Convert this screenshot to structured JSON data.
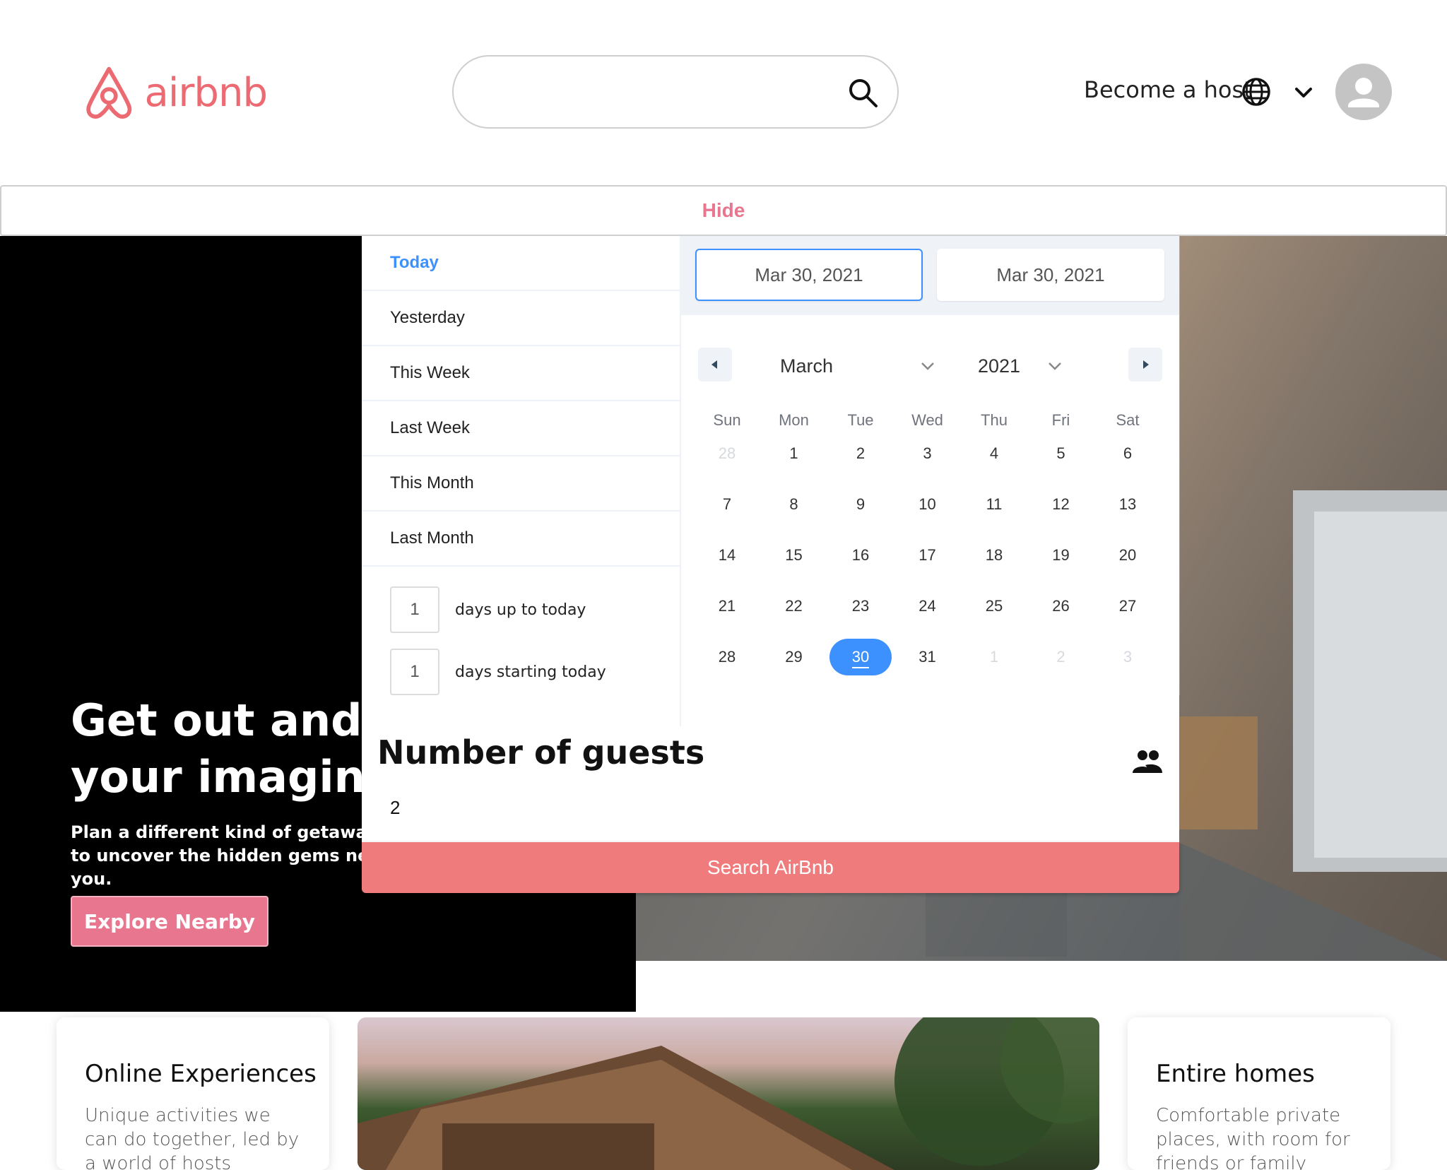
{
  "header": {
    "logo_text": "airbnb",
    "search_placeholder": "",
    "become_host": "Become a host",
    "brand_color": "#ec6b73"
  },
  "hide_label": "Hide",
  "hero": {
    "title_line1": "Get out and stretch",
    "title_line2": "your imagination",
    "subtitle": "Plan a different kind of getaway to uncover the hidden gems near you.",
    "cta": "Explore Nearby"
  },
  "picker": {
    "ranges": [
      "Today",
      "Yesterday",
      "This Week",
      "Last Week",
      "This Month",
      "Last Month"
    ],
    "active_range": "Today",
    "days_up_value": "1",
    "days_up_label": "days up to today",
    "days_start_value": "1",
    "days_start_label": "days starting today",
    "start_date": "Mar 30, 2021",
    "end_date": "Mar 30, 2021",
    "month": "March",
    "year": "2021",
    "weekdays": [
      "Sun",
      "Mon",
      "Tue",
      "Wed",
      "Thu",
      "Fri",
      "Sat"
    ],
    "weeks": [
      [
        "28",
        "1",
        "2",
        "3",
        "4",
        "5",
        "6"
      ],
      [
        "7",
        "8",
        "9",
        "10",
        "11",
        "12",
        "13"
      ],
      [
        "14",
        "15",
        "16",
        "17",
        "18",
        "19",
        "20"
      ],
      [
        "21",
        "22",
        "23",
        "24",
        "25",
        "26",
        "27"
      ],
      [
        "28",
        "29",
        "30",
        "31",
        "1",
        "2",
        "3"
      ]
    ],
    "selected_day": "30",
    "accent_color": "#3d91ff"
  },
  "guests": {
    "title": "Number of guests",
    "value": "2",
    "icon": "people-icon"
  },
  "search_button": "Search AirBnb",
  "cards": [
    {
      "title": "Online Experiences",
      "desc": "Unique activities we can do together, led by a world of hosts"
    },
    {
      "title": "Entire homes",
      "desc": "Comfortable private places, with room for friends or family"
    }
  ]
}
